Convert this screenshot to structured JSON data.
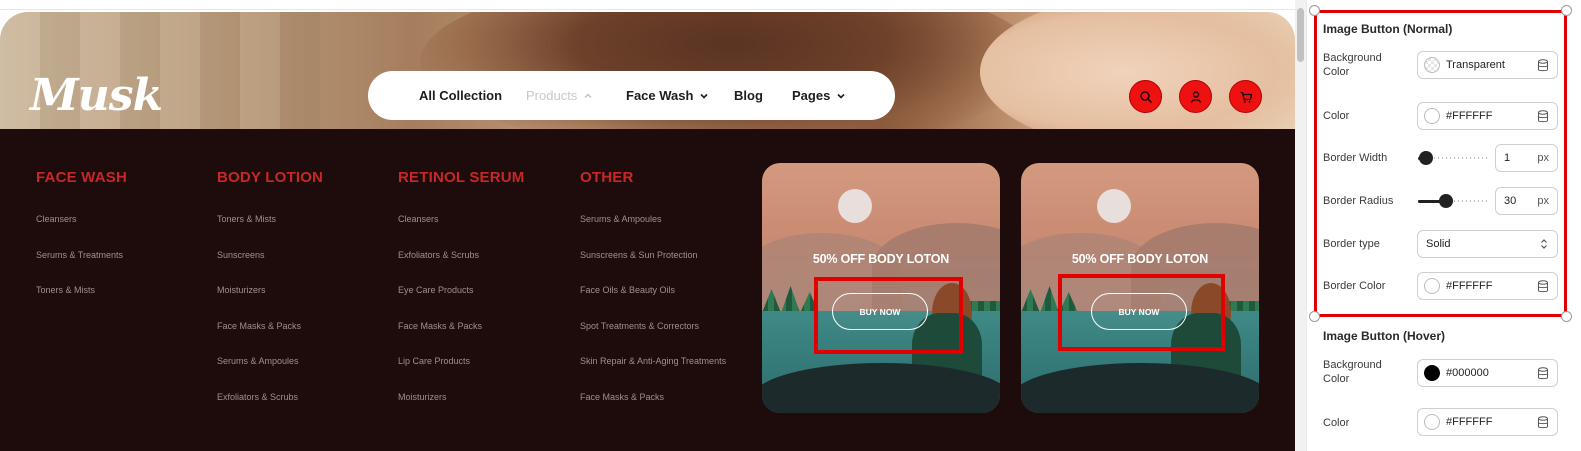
{
  "site": {
    "logo": "Musk",
    "nav": [
      {
        "label": "All Collection",
        "has_chevron": false,
        "state": "normal"
      },
      {
        "label": "Products",
        "has_chevron": true,
        "state": "active-muted"
      },
      {
        "label": "Face Wash",
        "has_chevron": true,
        "state": "normal"
      },
      {
        "label": "Blog",
        "has_chevron": false,
        "state": "normal"
      },
      {
        "label": "Pages",
        "has_chevron": true,
        "state": "normal"
      }
    ],
    "header_icons": [
      "search-icon",
      "user-icon",
      "cart-icon"
    ],
    "accent_color": "#ee1111",
    "mega_menu": {
      "background": "#1e0b0c",
      "heading_color": "#c62828",
      "columns": [
        {
          "heading": "FACE WASH",
          "items": [
            "Cleansers",
            "Serums & Treatments",
            "Toners & Mists"
          ]
        },
        {
          "heading": "BODY LOTION",
          "items": [
            "Toners & Mists",
            "Sunscreens",
            "Moisturizers",
            "Face Masks & Packs",
            "Serums & Ampoules",
            "Exfoliators & Scrubs"
          ]
        },
        {
          "heading": "RETINOL SERUM",
          "items": [
            "Cleansers",
            "Exfoliators & Scrubs",
            "Eye Care Products",
            "Face Masks & Packs",
            "Lip Care Products",
            "Moisturizers"
          ]
        },
        {
          "heading": "OTHER",
          "items": [
            "Serums & Ampoules",
            "Sunscreens & Sun Protection",
            "Face Oils & Beauty Oils",
            "Spot Treatments & Correctors",
            "Skin Repair & Anti-Aging Treatments",
            "Face Masks & Packs"
          ]
        }
      ],
      "promos": [
        {
          "title": "50% OFF BODY LOTON",
          "button": "BUY NOW"
        },
        {
          "title": "50% OFF BODY LOTON",
          "button": "BUY NOW"
        }
      ]
    }
  },
  "panel": {
    "normal": {
      "title": "Image Button (Normal)",
      "background_color": {
        "label": "Background Color",
        "value": "Transparent"
      },
      "color": {
        "label": "Color",
        "value": "#FFFFFF"
      },
      "border_width": {
        "label": "Border Width",
        "value": "1",
        "unit": "px",
        "slider_fraction": 0.02
      },
      "border_radius": {
        "label": "Border Radius",
        "value": "30",
        "unit": "px",
        "slider_fraction": 0.3
      },
      "border_type": {
        "label": "Border type",
        "value": "Solid"
      },
      "border_color": {
        "label": "Border Color",
        "value": "#FFFFFF"
      }
    },
    "hover": {
      "title": "Image Button (Hover)",
      "background_color": {
        "label": "Background Color",
        "value": "#000000"
      },
      "color": {
        "label": "Color",
        "value": "#FFFFFF"
      }
    },
    "selection_color": "#e00000"
  }
}
